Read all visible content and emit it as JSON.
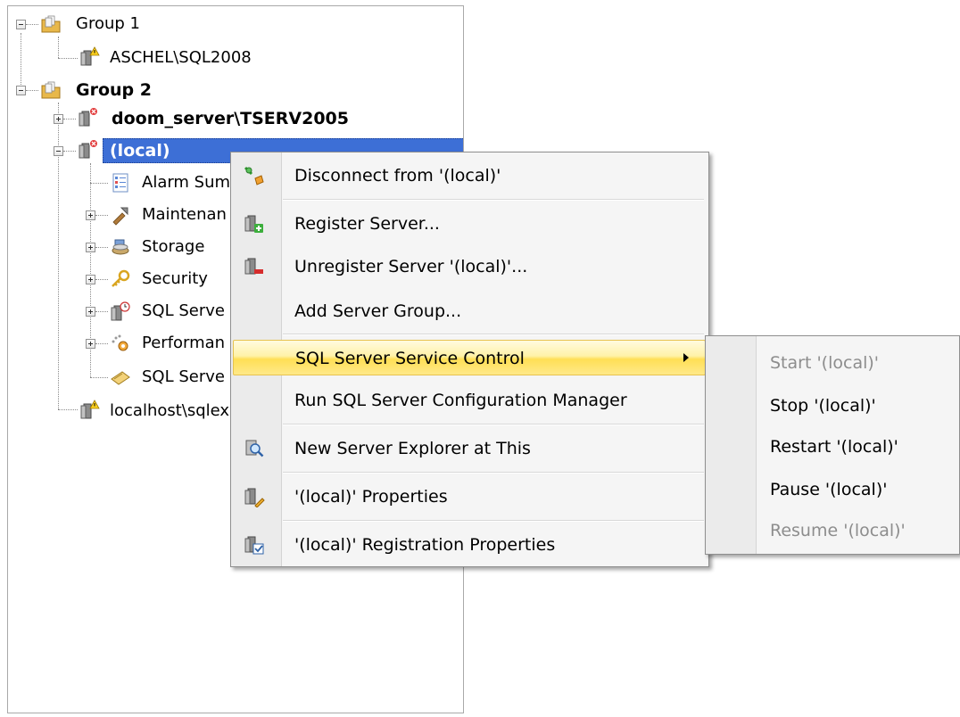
{
  "tree": {
    "group1": {
      "label": "Group 1"
    },
    "aschel": {
      "label": "ASCHEL\\SQL2008"
    },
    "group2": {
      "label": "Group 2"
    },
    "doom": {
      "label": "doom_server\\TSERV2005"
    },
    "local": {
      "label": "(local)"
    },
    "children": [
      {
        "label": "Alarm Sum",
        "icon": "alarm-summary-icon"
      },
      {
        "label": "Maintenan",
        "icon": "maintenance-icon"
      },
      {
        "label": "Storage",
        "icon": "storage-icon"
      },
      {
        "label": "Security",
        "icon": "key-icon"
      },
      {
        "label": "SQL Serve",
        "icon": "sql-server-agent-icon"
      },
      {
        "label": "Performan",
        "icon": "performance-icon"
      },
      {
        "label": "SQL Serve",
        "icon": "sql-script-icon"
      }
    ],
    "localhost": {
      "label": "localhost\\sqlex"
    }
  },
  "context_menu": {
    "items": [
      {
        "label": "Disconnect from '(local)'",
        "icon": "disconnect-plug-icon"
      },
      {
        "label": "Register Server...",
        "icon": "register-server-icon"
      },
      {
        "label": "Unregister Server '(local)'...",
        "icon": "unregister-server-icon"
      },
      {
        "label": "Add Server Group..."
      },
      {
        "label": "SQL Server Service Control",
        "highlighted": true,
        "has_submenu": true
      },
      {
        "label": "Run SQL Server Configuration Manager"
      },
      {
        "label": "New Server Explorer at This",
        "icon": "magnifier-icon"
      },
      {
        "label": "'(local)' Properties",
        "icon": "server-properties-icon"
      },
      {
        "label": "'(local)' Registration Properties",
        "icon": "registration-properties-icon"
      }
    ]
  },
  "sub_menu": {
    "items": [
      {
        "label": "Start '(local)'",
        "enabled": false
      },
      {
        "label": "Stop '(local)'",
        "enabled": true
      },
      {
        "label": "Restart '(local)'",
        "enabled": true
      },
      {
        "label": "Pause '(local)'",
        "enabled": true
      },
      {
        "label": "Resume '(local)'",
        "enabled": false
      }
    ]
  },
  "colors": {
    "selection": "#3d6fd6",
    "highlight": "#ffdf55",
    "disabled_text": "#8d8d8d"
  }
}
